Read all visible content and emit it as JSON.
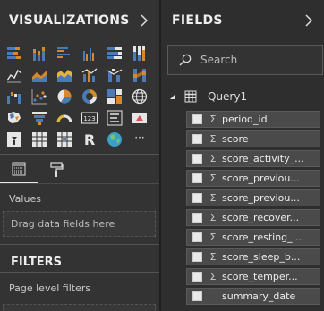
{
  "visualizations": {
    "title": "VISUALIZATIONS",
    "icons": [
      "stacked-bar-chart-icon",
      "stacked-column-chart-icon",
      "clustered-bar-chart-icon",
      "clustered-column-chart-icon",
      "100-stacked-bar-chart-icon",
      "100-stacked-column-chart-icon",
      "line-chart-icon",
      "area-chart-icon",
      "stacked-area-chart-icon",
      "line-and-column-chart-icon",
      "line-and-clustered-column-chart-icon",
      "ribbon-chart-icon",
      "waterfall-chart-icon",
      "scatter-chart-icon",
      "pie-chart-icon",
      "donut-chart-icon",
      "treemap-icon",
      "map-icon",
      "filled-map-icon",
      "funnel-icon",
      "gauge-icon",
      "card-icon",
      "multi-row-card-icon",
      "kpi-icon",
      "slicer-icon",
      "table-icon",
      "matrix-icon",
      "r-visual-icon",
      "globe-map-icon",
      "more-options-icon"
    ],
    "r_label": "R",
    "card_label": "123",
    "more_label": "···",
    "values_label": "Values",
    "drop_placeholder": "Drag data fields here"
  },
  "filters": {
    "title": "FILTERS",
    "page_level_label": "Page level filters"
  },
  "fields": {
    "title": "FIELDS",
    "search_placeholder": "Search",
    "table_name": "Query1",
    "items": [
      {
        "name": "period_id",
        "sigma": true
      },
      {
        "name": "score",
        "sigma": true
      },
      {
        "name": "score_activity_...",
        "sigma": true
      },
      {
        "name": "score_previou...",
        "sigma": true
      },
      {
        "name": "score_previou...",
        "sigma": true
      },
      {
        "name": "score_recover...",
        "sigma": true
      },
      {
        "name": "score_resting_...",
        "sigma": true
      },
      {
        "name": "score_sleep_b...",
        "sigma": true
      },
      {
        "name": "score_temper...",
        "sigma": true
      },
      {
        "name": "summary_date",
        "sigma": false
      }
    ],
    "sigma_symbol": "Σ"
  }
}
